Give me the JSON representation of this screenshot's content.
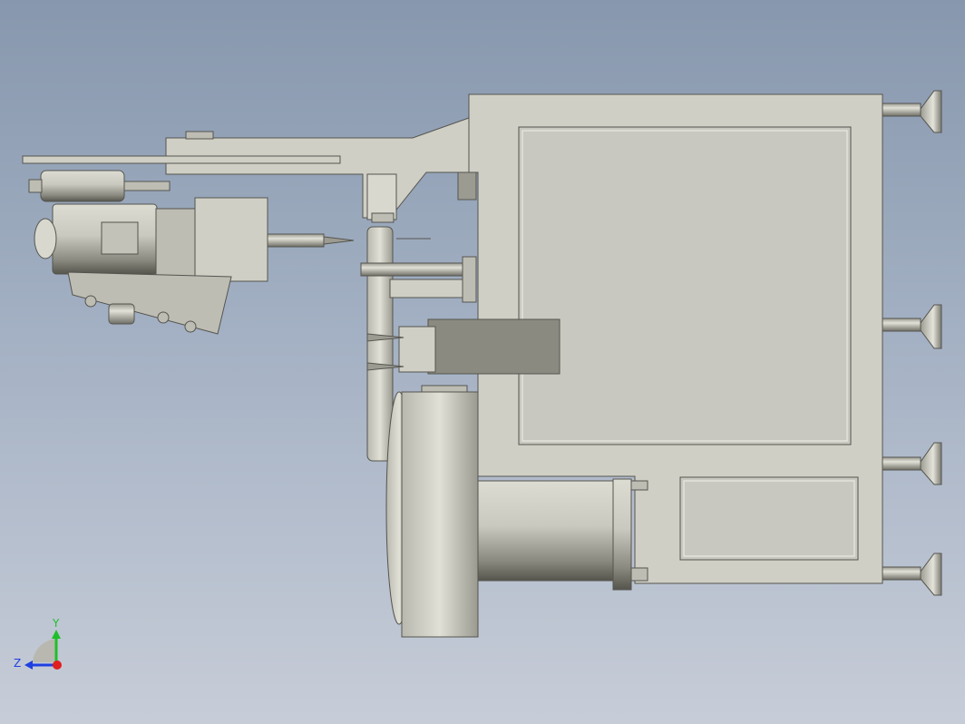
{
  "viewport": {
    "background_top": "#8797ad",
    "background_bottom": "#c7cdd8",
    "part_color": "#cfcfc6",
    "edge_color": "#55554f"
  },
  "triad": {
    "y_label": "Y",
    "z_label": "Z",
    "y_color": "#1fbf2a",
    "z_color": "#1f3fe0",
    "x_color": "#e01f1f"
  }
}
